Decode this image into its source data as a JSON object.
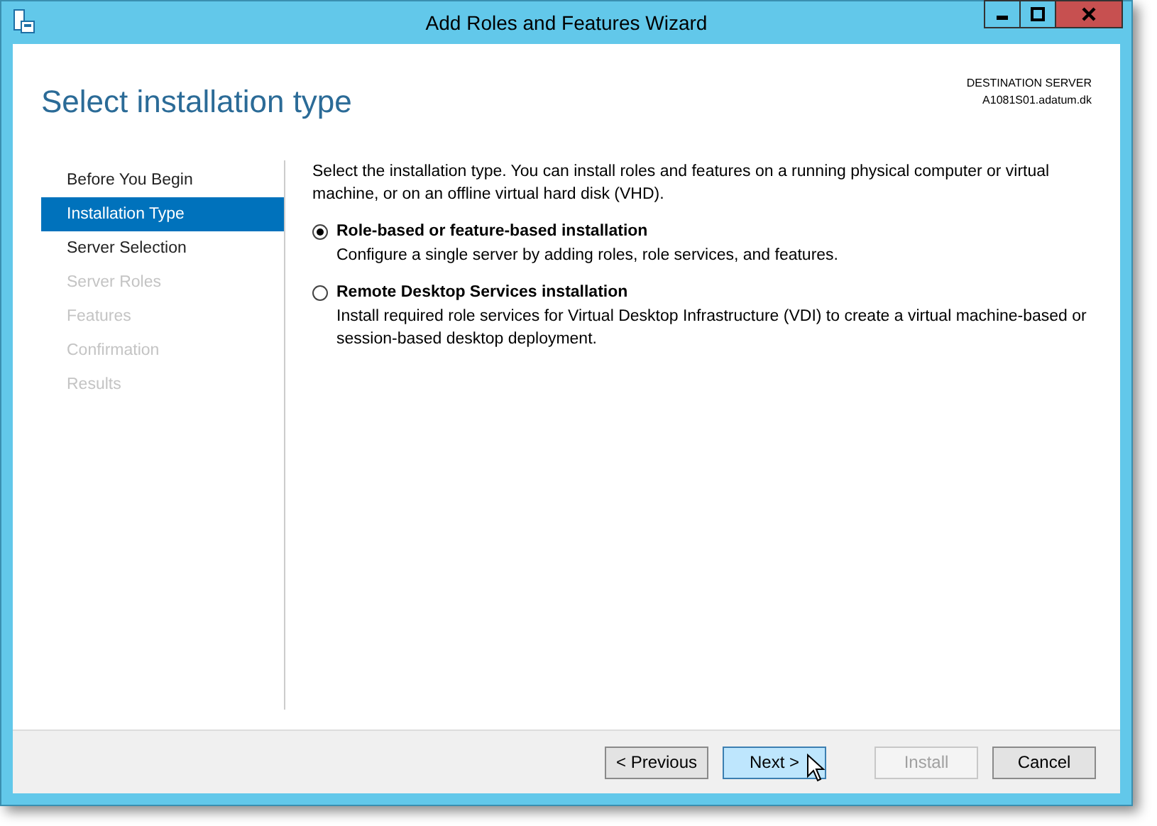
{
  "window": {
    "title": "Add Roles and Features Wizard"
  },
  "page_title": "Select installation type",
  "destination": {
    "label": "DESTINATION SERVER",
    "server": "A1081S01.adatum.dk"
  },
  "steps": [
    {
      "label": "Before You Begin",
      "selected": false,
      "disabled": false
    },
    {
      "label": "Installation Type",
      "selected": true,
      "disabled": false
    },
    {
      "label": "Server Selection",
      "selected": false,
      "disabled": false
    },
    {
      "label": "Server Roles",
      "selected": false,
      "disabled": true
    },
    {
      "label": "Features",
      "selected": false,
      "disabled": true
    },
    {
      "label": "Confirmation",
      "selected": false,
      "disabled": true
    },
    {
      "label": "Results",
      "selected": false,
      "disabled": true
    }
  ],
  "intro": "Select the installation type. You can install roles and features on a running physical computer or virtual machine, or on an offline virtual hard disk (VHD).",
  "options": [
    {
      "label": "Role-based or feature-based installation",
      "description": "Configure a single server by adding roles, role services, and features.",
      "selected": true
    },
    {
      "label": "Remote Desktop Services installation",
      "description": "Install required role services for Virtual Desktop Infrastructure (VDI) to create a virtual machine-based or session-based desktop deployment.",
      "selected": false
    }
  ],
  "buttons": [
    {
      "label": "< Previous",
      "disabled": false,
      "hovered": false
    },
    {
      "label": "Next >",
      "disabled": false,
      "hovered": true
    },
    {
      "label": "Install",
      "disabled": true,
      "hovered": false
    },
    {
      "label": "Cancel",
      "disabled": false,
      "hovered": false
    }
  ]
}
